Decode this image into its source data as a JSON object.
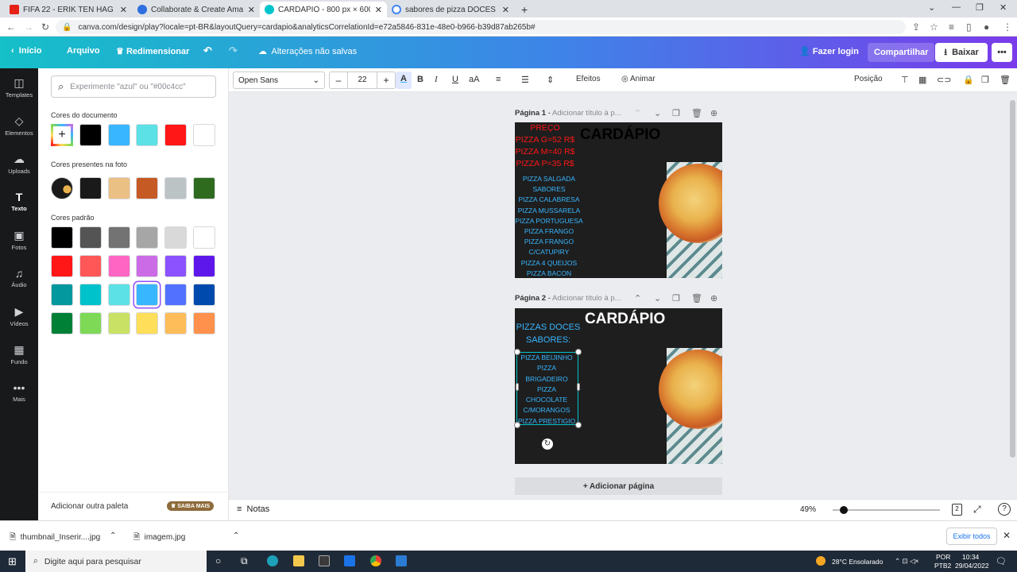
{
  "browser": {
    "tabs": [
      {
        "title": "FIFA 22 - ERIK TEN HAG Face (Te",
        "color": "#e62117"
      },
      {
        "title": "Collaborate & Create Amazing G",
        "color": "#2f6fe0"
      },
      {
        "title": "CARDÁPIO - 800 px × 600 px",
        "color": "#00c4cc",
        "active": true
      },
      {
        "title": "sabores de pizza DOCES - Pesqu",
        "color": "#4285f4"
      }
    ],
    "url": "canva.com/design/play?locale=pt-BR&layoutQuery=cardapio&analyticsCorrelationId=e72a5846-831e-48e0-b966-b39d87ab265b#"
  },
  "header": {
    "home": "Início",
    "file": "Arquivo",
    "resize": "Redimensionar",
    "unsaved": "Alterações não salvas",
    "login": "Fazer login",
    "share": "Compartilhar",
    "download": "Baixar"
  },
  "rail": [
    {
      "label": "Templates",
      "icon": "◫"
    },
    {
      "label": "Elementos",
      "icon": "◇"
    },
    {
      "label": "Uploads",
      "icon": "☁"
    },
    {
      "label": "Texto",
      "icon": "T",
      "selected": true
    },
    {
      "label": "Fotos",
      "icon": "▣"
    },
    {
      "label": "Áudio",
      "icon": "♫"
    },
    {
      "label": "Vídeos",
      "icon": "▶"
    },
    {
      "label": "Fundo",
      "icon": "▦"
    },
    {
      "label": "Mais",
      "icon": "•••"
    }
  ],
  "panel": {
    "search_placeholder": "Experimente \"azul\" ou \"#00c4cc\"",
    "doc_colors_label": "Cores do documento",
    "doc_colors": [
      "#000000",
      "#38b6ff",
      "#5ce1e6",
      "#ff1616",
      "#ffffff"
    ],
    "photo_colors_label": "Cores presentes na foto",
    "photo_colors": [
      "#1a1a1a",
      "#ebc084",
      "#c65a25",
      "#bcc3c4",
      "#2e6b1f"
    ],
    "default_colors_label": "Cores padrão",
    "default_colors": [
      "#000000",
      "#545454",
      "#737373",
      "#a6a6a6",
      "#d9d9d9",
      "#ffffff",
      "#ff1616",
      "#ff5757",
      "#ff66c4",
      "#cb6ce6",
      "#8c52ff",
      "#5e17eb",
      "#03989e",
      "#00c2cb",
      "#5ce1e6",
      "#38b6ff",
      "#5271ff",
      "#004aad",
      "#008037",
      "#7ed957",
      "#c9e265",
      "#ffde59",
      "#ffbd59",
      "#ff914d"
    ],
    "add_palette": "Adicionar outra paleta",
    "learn_more": "SAIBA MAIS"
  },
  "toolbar": {
    "font": "Open Sans",
    "size": "22",
    "effects": "Efeitos",
    "animate": "Animar",
    "position": "Posição"
  },
  "pages": [
    {
      "label": "Página 1",
      "title_placeholder": "Adicionar título à p...",
      "heading": "CARDÁPIO",
      "price_lines": [
        "PREÇO",
        "PIZZA G=52 R$",
        "PIZZA M=40 R$",
        "PIZZA P=35 R$"
      ],
      "flavor_lines": [
        "PIZZA SALGADA",
        "SABORES",
        "PIZZA CALABRESA",
        "PIZZA MUSSARELA",
        "PIZZA PORTUGUESA",
        "PIZZA FRANGO",
        "PIZZA FRANGO",
        "C/CATUPIRY",
        "PIZZA 4 QUEIJOS",
        "PIZZA BACON"
      ]
    },
    {
      "label": "Página 2",
      "title_placeholder": "Adicionar título à p...",
      "heading": "CARDÁPIO",
      "sub_lines": [
        "PIZZAS DOCES",
        "SABORES:"
      ],
      "flavor_lines": [
        "PIZZA BEIJINHO",
        "PIZZA",
        "BRIGADEIRO",
        "PIZZA",
        "CHOCOLATE",
        "C/MORANGOS",
        "PIZZA PRESTIGIO"
      ]
    }
  ],
  "add_page": "+ Adicionar página",
  "bottom": {
    "notes": "Notas",
    "zoom": "49%",
    "zoom_level": 0.1,
    "page_count": "2"
  },
  "downloads": {
    "items": [
      "thumbnail_Inserir....jpg",
      "imagem.jpg"
    ],
    "show_all": "Exibir todos"
  },
  "taskbar": {
    "search": "Digite aqui para pesquisar",
    "weather": "28°C  Ensolarado",
    "lang": "POR",
    "lang2": "PTB2",
    "time": "10:34",
    "date": "29/04/2022"
  }
}
